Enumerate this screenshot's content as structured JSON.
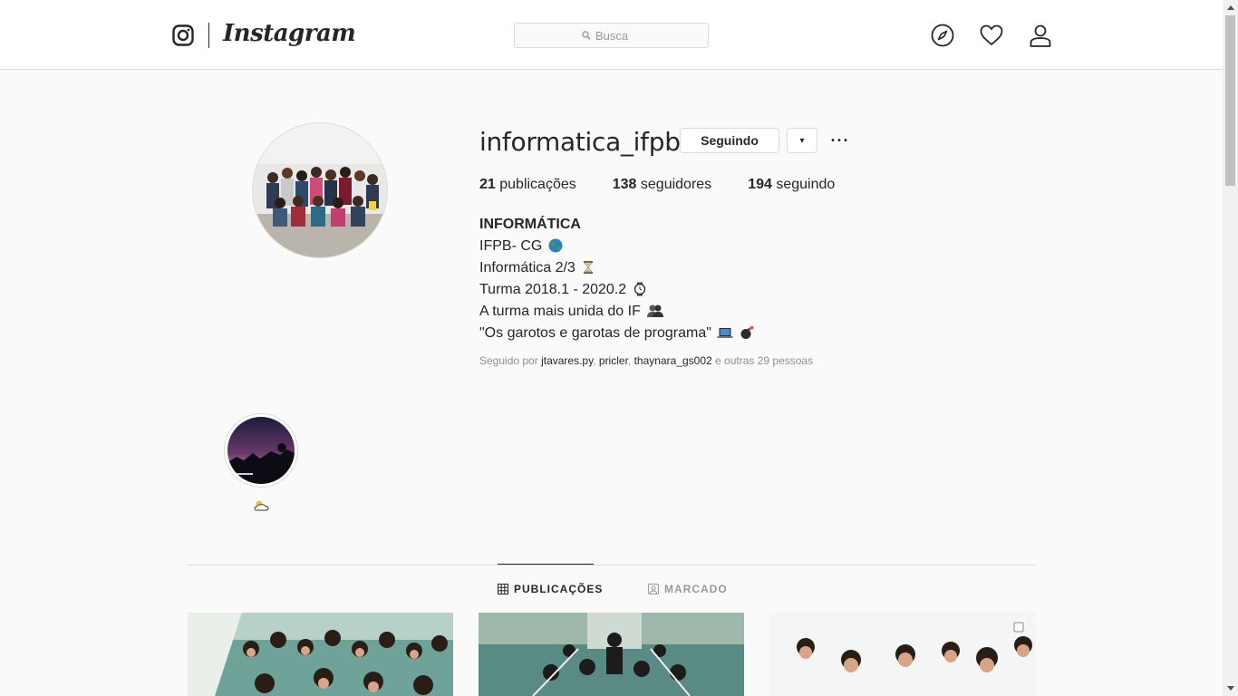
{
  "header": {
    "logo_text": "Instagram",
    "search_placeholder": "Busca",
    "icons": [
      "instagram-glyph-icon",
      "compass-icon",
      "heart-icon",
      "user-icon"
    ]
  },
  "profile": {
    "username": "informatica_ifpb2",
    "following_button": "Seguindo",
    "dropdown_symbol": "▾",
    "more_symbol": "···",
    "stats": {
      "posts_count": "21",
      "posts_label": "publicações",
      "followers_count": "138",
      "followers_label": "seguidores",
      "following_count": "194",
      "following_label": "seguindo"
    },
    "bio": {
      "name": "INFORMÁTICA",
      "line1": "IFPB- CG",
      "line2": "Informática 2/3",
      "line3": "Turma 2018.1 - 2020.2",
      "line4": "A turma mais unida do IF",
      "line5": "\"Os garotos e garotas de programa\""
    },
    "followed_by": {
      "prefix": "Seguido por",
      "user1": "jtavares.py",
      "sep1": ",",
      "user2": "pricler",
      "sep2": ",",
      "user3": "thaynara_gs002",
      "suffix": "e outras 29 pessoas"
    }
  },
  "highlights": [
    {
      "label_icon": "cloud-sun-icon"
    }
  ],
  "tabs": [
    {
      "label": "PUBLICAÇÕES",
      "icon": "grid-icon",
      "active": true
    },
    {
      "label": "MARCADO",
      "icon": "tag-icon",
      "active": false
    }
  ],
  "colors": {
    "background": "#fafafa",
    "text": "#262626",
    "muted": "#8e8e8e",
    "border": "#dbdbdb"
  }
}
